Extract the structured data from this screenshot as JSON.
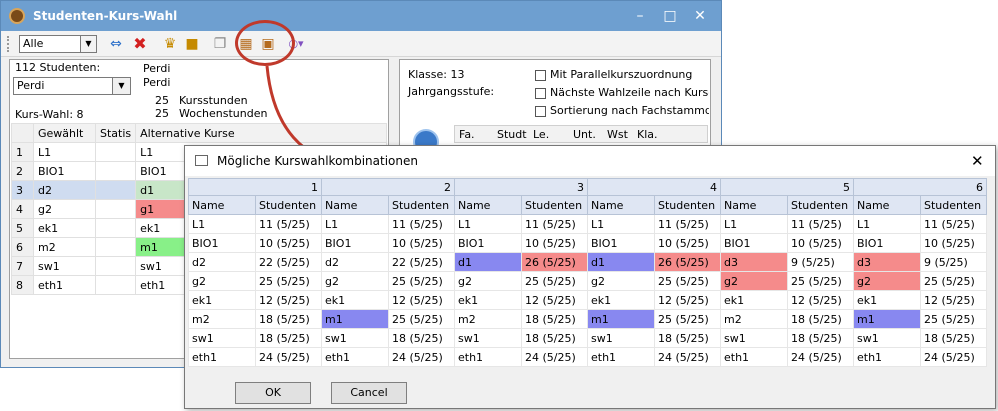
{
  "main": {
    "title": "Studenten-Kurs-Wahl",
    "filter_value": "Alle",
    "student_count": "112 Studenten:",
    "student_value": "Perdi",
    "name_line1": "Perdi",
    "name_line2": "Perdi",
    "kursstunden_num": "25",
    "kursstunden_label": "Kursstunden",
    "wochenstunden_num": "25",
    "wochenstunden_label": "Wochenstunden",
    "kurswahl": "Kurs-Wahl: 8",
    "grid_headers": [
      "Gewählt",
      "Statis",
      "Alternative Kurse"
    ],
    "grid_rows": [
      {
        "n": "1",
        "g": "L1",
        "a": "L1",
        "color": ""
      },
      {
        "n": "2",
        "g": "BIO1",
        "a": "BIO1",
        "color": ""
      },
      {
        "n": "3",
        "g": "d2",
        "a": "d1",
        "color": "#c8e6c8"
      },
      {
        "n": "4",
        "g": "g2",
        "a": "g1",
        "color": "#f58b8b"
      },
      {
        "n": "5",
        "g": "ek1",
        "a": "ek1",
        "color": ""
      },
      {
        "n": "6",
        "g": "m2",
        "a": "m1",
        "color": "#88f088"
      },
      {
        "n": "7",
        "g": "sw1",
        "a": "sw1",
        "color": ""
      },
      {
        "n": "8",
        "g": "eth1",
        "a": "eth1",
        "color": ""
      }
    ],
    "klasse": "Klasse: 13",
    "jahrgangsstufe": "Jahrgangsstufe:",
    "checkboxes": [
      "Mit Parallelkurszuordnung",
      "Nächste Wahlzeile nach Kurseintr",
      "Sortierung nach Fachstammdaten"
    ],
    "right_headers": [
      "Fa.",
      "Studt",
      "Le.",
      "Unt.",
      "Wst",
      "Kla."
    ]
  },
  "dialog": {
    "title": "Mögliche Kurswahlkombinationen",
    "groups": [
      "1",
      "2",
      "3",
      "4",
      "5",
      "6"
    ],
    "col_name": "Name",
    "col_students": "Studenten",
    "rows": [
      [
        [
          "L1",
          "11 (5/25)"
        ],
        [
          "L1",
          "11 (5/25)"
        ],
        [
          "L1",
          "11 (5/25)"
        ],
        [
          "L1",
          "11 (5/25)"
        ],
        [
          "L1",
          "11 (5/25)"
        ],
        [
          "L1",
          "11 (5/25)"
        ]
      ],
      [
        [
          "BIO1",
          "10 (5/25)"
        ],
        [
          "BIO1",
          "10 (5/25)"
        ],
        [
          "BIO1",
          "10 (5/25)"
        ],
        [
          "BIO1",
          "10 (5/25)"
        ],
        [
          "BIO1",
          "10 (5/25)"
        ],
        [
          "BIO1",
          "10 (5/25)"
        ]
      ],
      [
        [
          "d2",
          "22 (5/25)"
        ],
        [
          "d2",
          "22 (5/25)"
        ],
        [
          "d1",
          "26 (5/25)"
        ],
        [
          "d1",
          "26 (5/25)"
        ],
        [
          "d3",
          "9 (5/25)"
        ],
        [
          "d3",
          "9 (5/25)"
        ]
      ],
      [
        [
          "g2",
          "25 (5/25)"
        ],
        [
          "g2",
          "25 (5/25)"
        ],
        [
          "g2",
          "25 (5/25)"
        ],
        [
          "g2",
          "25 (5/25)"
        ],
        [
          "g2",
          "25 (5/25)"
        ],
        [
          "g2",
          "25 (5/25)"
        ]
      ],
      [
        [
          "ek1",
          "12 (5/25)"
        ],
        [
          "ek1",
          "12 (5/25)"
        ],
        [
          "ek1",
          "12 (5/25)"
        ],
        [
          "ek1",
          "12 (5/25)"
        ],
        [
          "ek1",
          "12 (5/25)"
        ],
        [
          "ek1",
          "12 (5/25)"
        ]
      ],
      [
        [
          "m2",
          "18 (5/25)"
        ],
        [
          "m1",
          "25 (5/25)"
        ],
        [
          "m2",
          "18 (5/25)"
        ],
        [
          "m1",
          "25 (5/25)"
        ],
        [
          "m2",
          "18 (5/25)"
        ],
        [
          "m1",
          "25 (5/25)"
        ]
      ],
      [
        [
          "sw1",
          "18 (5/25)"
        ],
        [
          "sw1",
          "18 (5/25)"
        ],
        [
          "sw1",
          "18 (5/25)"
        ],
        [
          "sw1",
          "18 (5/25)"
        ],
        [
          "sw1",
          "18 (5/25)"
        ],
        [
          "sw1",
          "18 (5/25)"
        ]
      ],
      [
        [
          "eth1",
          "24 (5/25)"
        ],
        [
          "eth1",
          "24 (5/25)"
        ],
        [
          "eth1",
          "24 (5/25)"
        ],
        [
          "eth1",
          "24 (5/25)"
        ],
        [
          "eth1",
          "24 (5/25)"
        ],
        [
          "eth1",
          "24 (5/25)"
        ]
      ]
    ],
    "highlights": {
      "2": {
        "2": [
          "blue",
          "red"
        ],
        "3": [
          "blue",
          "red"
        ],
        "4": [
          "red",
          ""
        ],
        "5": [
          "red",
          ""
        ]
      },
      "3": {
        "4": [
          "red",
          ""
        ],
        "5": [
          "red",
          ""
        ]
      },
      "5": {
        "1": [
          "blue",
          ""
        ],
        "3": [
          "blue",
          ""
        ],
        "5": [
          "blue",
          ""
        ]
      }
    },
    "ok_label": "OK",
    "cancel_label": "Cancel"
  }
}
